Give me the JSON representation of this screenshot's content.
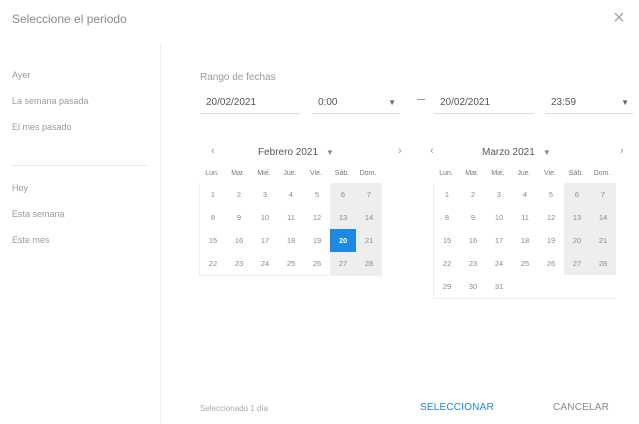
{
  "dialog": {
    "title": "Seleccione el periodo",
    "close_icon": "×"
  },
  "sidebar": {
    "items": [
      {
        "label": "Ayer"
      },
      {
        "label": "La semana pasada"
      },
      {
        "label": "El mes pasado"
      },
      {
        "label": "Hoy"
      },
      {
        "label": "Esta semana"
      },
      {
        "label": "Este mes"
      }
    ]
  },
  "range": {
    "label": "Rango de fechas",
    "start_date": "20/02/2021",
    "start_time": "0:00",
    "end_date": "20/02/2021",
    "end_time": "23:59",
    "caret": "▼"
  },
  "calendars": {
    "prev_icon": "‹",
    "next_icon": "›",
    "dd_icon": "▼",
    "weekdays": [
      "Lun.",
      "Mar.",
      "Mié.",
      "Jue.",
      "Vie.",
      "Sáb.",
      "Dom."
    ],
    "left": {
      "title": "Febrero 2021",
      "weeks": [
        [
          "1",
          "2",
          "3",
          "4",
          "5",
          "6",
          "7"
        ],
        [
          "8",
          "9",
          "10",
          "11",
          "12",
          "13",
          "14"
        ],
        [
          "15",
          "16",
          "17",
          "18",
          "19",
          "20",
          "21"
        ],
        [
          "22",
          "23",
          "24",
          "25",
          "26",
          "27",
          "28"
        ]
      ],
      "selected": "20"
    },
    "right": {
      "title": "Marzo 2021",
      "weeks": [
        [
          "1",
          "2",
          "3",
          "4",
          "5",
          "6",
          "7"
        ],
        [
          "8",
          "9",
          "10",
          "11",
          "12",
          "13",
          "14"
        ],
        [
          "15",
          "16",
          "17",
          "18",
          "19",
          "20",
          "21"
        ],
        [
          "22",
          "23",
          "24",
          "25",
          "26",
          "27",
          "28"
        ],
        [
          "29",
          "30",
          "31",
          "",
          "",
          "",
          ""
        ]
      ]
    }
  },
  "footer": {
    "selected_text": "Seleccionado 1 día",
    "select_label": "SELECCIONAR",
    "cancel_label": "CANCELAR"
  },
  "colors": {
    "accent": "#1e88e5",
    "weekend_bg": "#eeeeee"
  }
}
